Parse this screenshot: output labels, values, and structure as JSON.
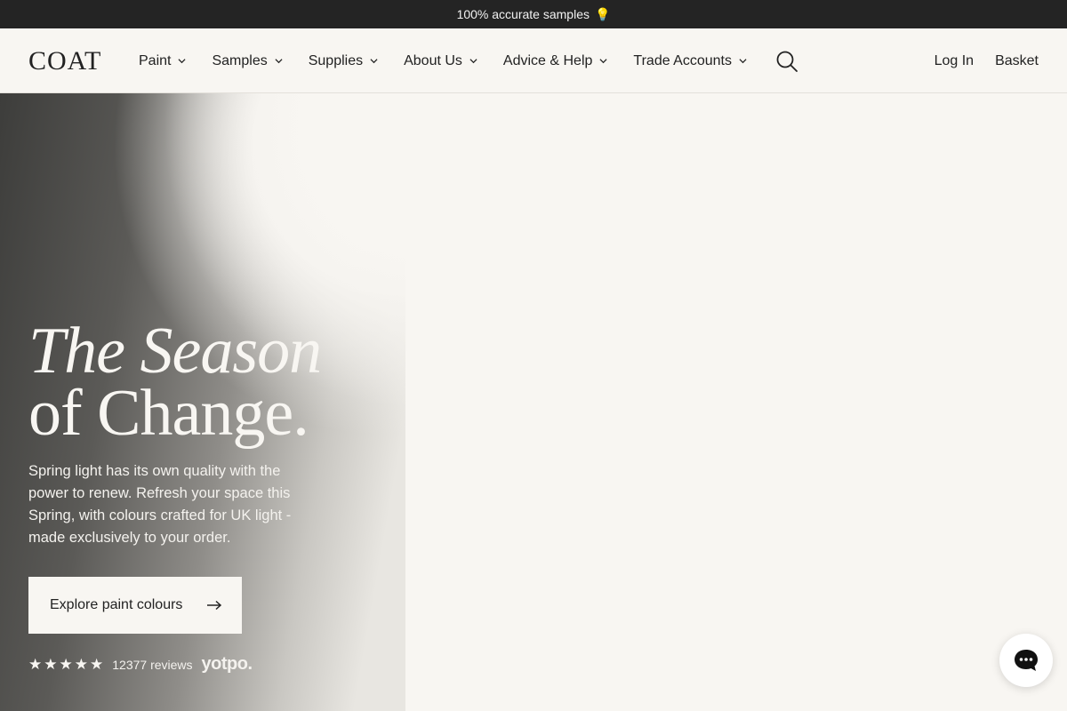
{
  "announcement": {
    "text": "100% accurate samples",
    "icon": "lightbulb-icon"
  },
  "header": {
    "logo": "COAT",
    "nav": [
      "Paint",
      "Samples",
      "Supplies",
      "About Us",
      "Advice & Help",
      "Trade Accounts"
    ],
    "search_icon": "search-icon",
    "login": "Log In",
    "basket": "Basket"
  },
  "hero": {
    "title_line1": "The Season",
    "title_line2": "of Change.",
    "description": "Spring light has its own quality with the power to renew. Refresh your space this Spring, with colours crafted for UK light - made exclusively to your order.",
    "cta_label": "Explore paint colours",
    "cta_icon": "arrow-right-icon",
    "rating_stars": 5,
    "review_count": "12377 reviews",
    "review_brand": "yotpo."
  },
  "chat": {
    "icon": "chat-bubble-icon"
  },
  "colors": {
    "background": "#f8f6f2",
    "announce_bg": "#242424",
    "text": "#222222"
  }
}
